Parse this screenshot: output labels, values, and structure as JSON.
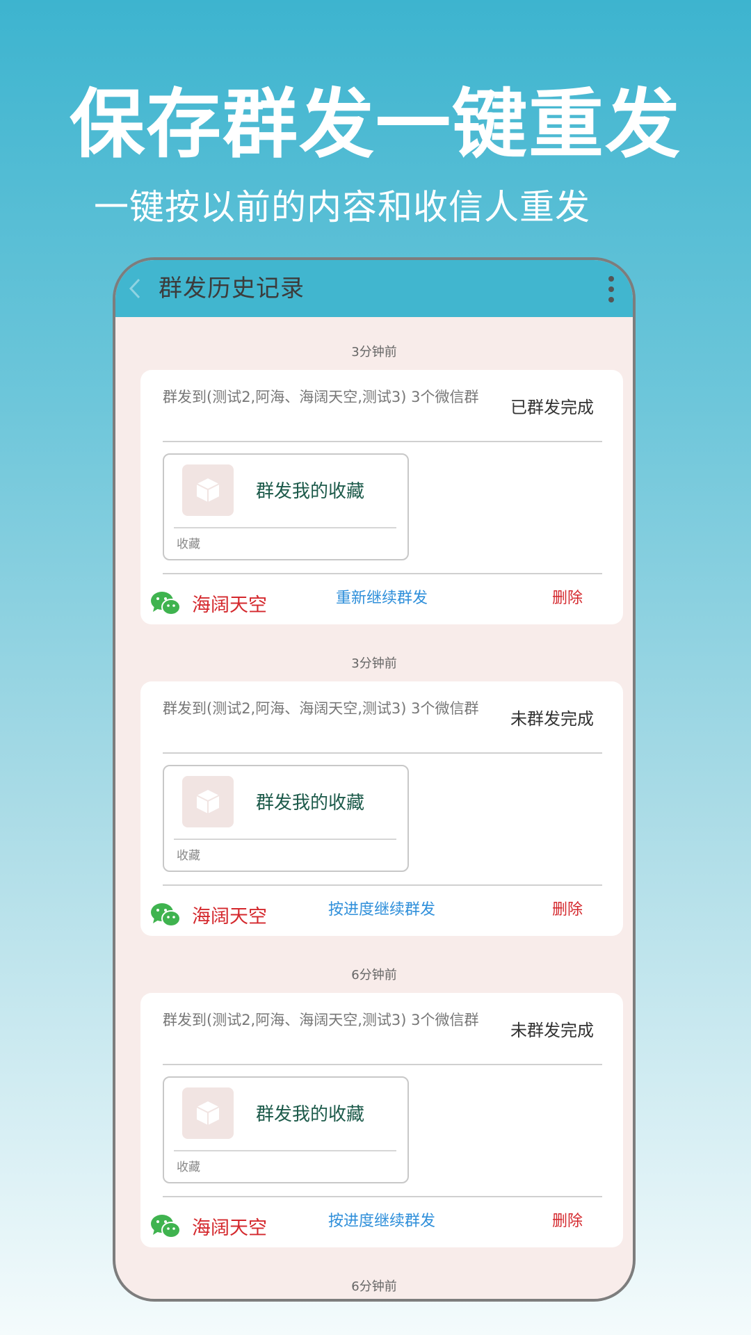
{
  "hero": {
    "title": "保存群发一键重发",
    "subtitle": "一键按以前的内容和收信人重发"
  },
  "appbar": {
    "title": "群发历史记录",
    "back_icon": "chevron-left-icon",
    "more_icon": "more-vertical-icon"
  },
  "records": [
    {
      "time": "3分钟前",
      "description": "群发到(测试2,阿海、海阔天空,测试3) 3个微信群",
      "status": "已群发完成",
      "favorite_title": "群发我的收藏",
      "favorite_caption": "收藏",
      "group_name": "海阔天空",
      "action": "重新继续群发",
      "delete": "删除"
    },
    {
      "time": "3分钟前",
      "description": "群发到(测试2,阿海、海阔天空,测试3) 3个微信群",
      "status": "未群发完成",
      "favorite_title": "群发我的收藏",
      "favorite_caption": "收藏",
      "group_name": "海阔天空",
      "action": "按进度继续群发",
      "delete": "删除"
    },
    {
      "time": "6分钟前",
      "description": "群发到(测试2,阿海、海阔天空,测试3) 3个微信群",
      "status": "未群发完成",
      "favorite_title": "群发我的收藏",
      "favorite_caption": "收藏",
      "group_name": "海阔天空",
      "action": "按进度继续群发",
      "delete": "删除"
    }
  ],
  "trailing_time": "6分钟前",
  "colors": {
    "appbar": "#41b6cf",
    "accent_blue": "#2f8fda",
    "danger_red": "#d4282d",
    "list_background": "#f8ecea"
  }
}
